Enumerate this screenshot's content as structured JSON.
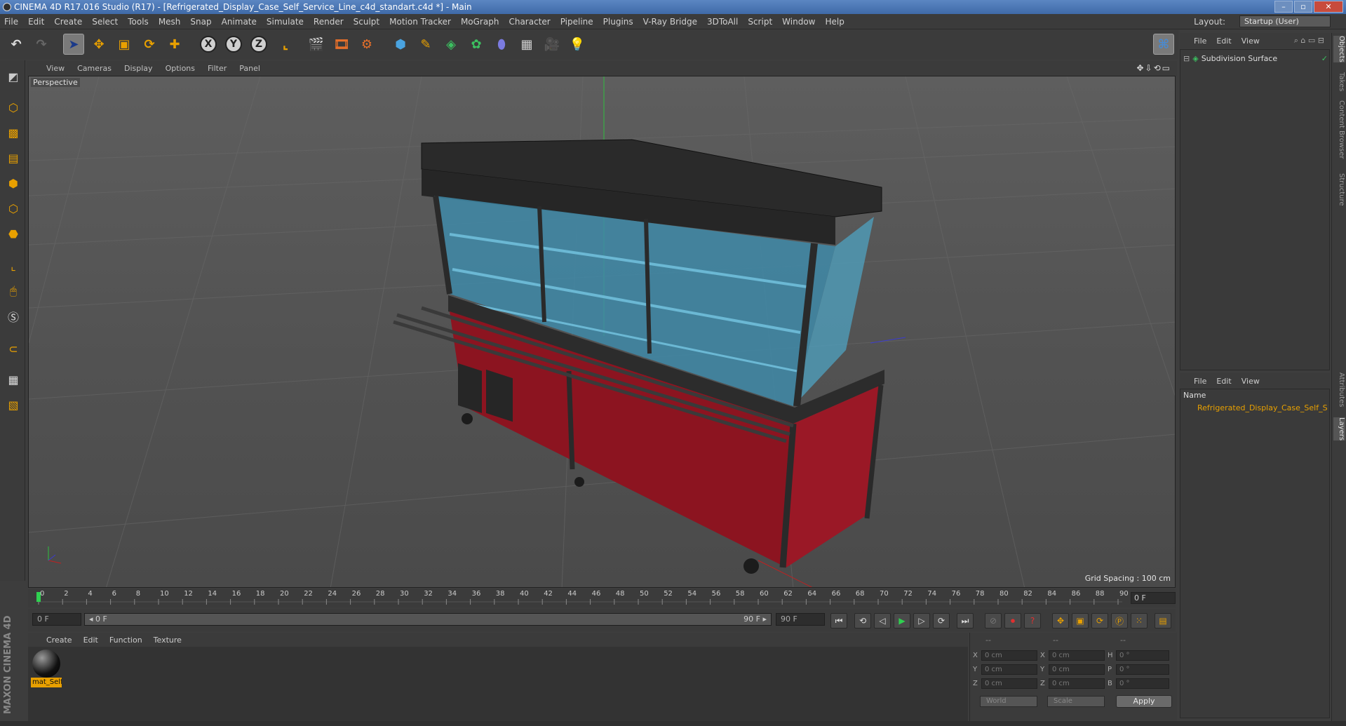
{
  "window": {
    "title": "CINEMA 4D R17.016 Studio (R17) - [Refrigerated_Display_Case_Self_Service_Line_c4d_standart.c4d *] - Main",
    "controls": [
      "–",
      "▫",
      "✕"
    ]
  },
  "menubar": {
    "items": [
      "File",
      "Edit",
      "Create",
      "Select",
      "Tools",
      "Mesh",
      "Snap",
      "Animate",
      "Simulate",
      "Render",
      "Sculpt",
      "Motion Tracker",
      "MoGraph",
      "Character",
      "Pipeline",
      "Plugins",
      "V-Ray Bridge",
      "3DToAll",
      "Script",
      "Window",
      "Help"
    ],
    "layout_label": "Layout:",
    "layout_value": "Startup (User)"
  },
  "toolbar": {
    "axis_x": "X",
    "axis_y": "Y",
    "axis_z": "Z"
  },
  "viewport": {
    "menu": [
      "View",
      "Cameras",
      "Display",
      "Options",
      "Filter",
      "Panel"
    ],
    "nav_icons": "✥⇩⟲▭",
    "label": "Perspective",
    "grid_spacing": "Grid Spacing : 100 cm"
  },
  "timeline": {
    "ticks": [
      "0",
      "2",
      "4",
      "6",
      "8",
      "10",
      "12",
      "14",
      "16",
      "18",
      "20",
      "22",
      "24",
      "26",
      "28",
      "30",
      "32",
      "34",
      "36",
      "38",
      "40",
      "42",
      "44",
      "46",
      "48",
      "50",
      "52",
      "54",
      "56",
      "58",
      "60",
      "62",
      "64",
      "66",
      "68",
      "70",
      "72",
      "74",
      "76",
      "78",
      "80",
      "82",
      "84",
      "86",
      "88",
      "90"
    ],
    "current_frame": "0 F",
    "start_frame": "0 F",
    "range_start": "◂ 0 F",
    "range_end": "90 F ▸",
    "end_frame": "90 F"
  },
  "material_manager": {
    "menu": [
      "Create",
      "Edit",
      "Function",
      "Texture"
    ],
    "material_name": "mat_Self"
  },
  "coordinates": {
    "header": [
      "--",
      "--",
      "--"
    ],
    "rows": [
      {
        "l1": "X",
        "v1": "0 cm",
        "l2": "X",
        "v2": "0 cm",
        "l3": "H",
        "v3": "0 °"
      },
      {
        "l1": "Y",
        "v1": "0 cm",
        "l2": "Y",
        "v2": "0 cm",
        "l3": "P",
        "v3": "0 °"
      },
      {
        "l1": "Z",
        "v1": "0 cm",
        "l2": "Z",
        "v2": "0 cm",
        "l3": "B",
        "v3": "0 °"
      }
    ],
    "mode1": "World",
    "mode2": "Scale",
    "apply": "Apply"
  },
  "object_manager": {
    "menu": [
      "File",
      "Edit",
      "View"
    ],
    "objects": [
      "Subdivision Surface"
    ]
  },
  "layer_manager": {
    "menu": [
      "File",
      "Edit",
      "View"
    ],
    "column": "Name",
    "layers": [
      "Refrigerated_Display_Case_Self_Se"
    ]
  },
  "side_tabs": [
    "Objects",
    "Takes",
    "Content Browser",
    "Structure",
    "Attributes",
    "Layers"
  ],
  "logo_text": "MAXON CINEMA 4D",
  "colors": {
    "accent": "#e8a000",
    "cabinet_red": "#8c1420",
    "glass_blue": "#3f8aa8",
    "frame_dark": "#2a2a2a"
  }
}
